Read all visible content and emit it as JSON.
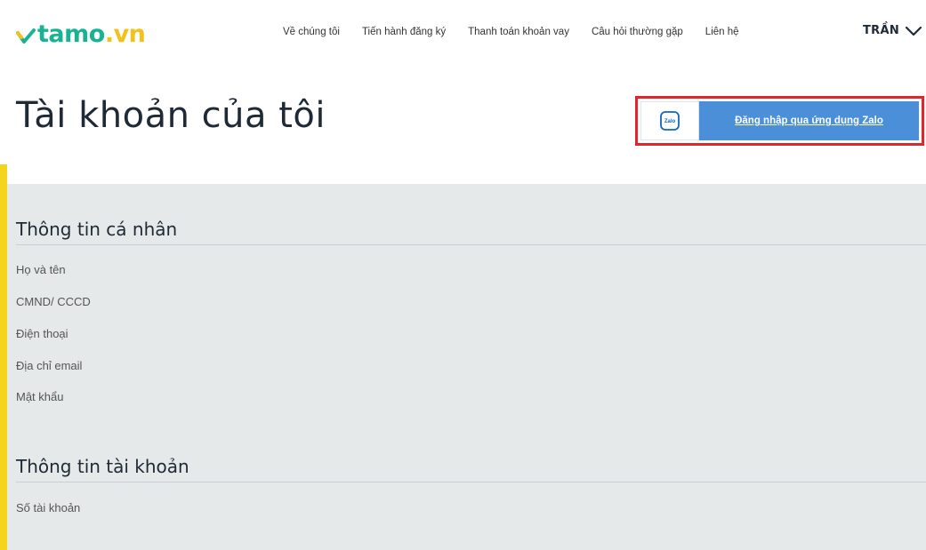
{
  "header": {
    "logo": {
      "brand": "tamo",
      "suffix": ".vn"
    },
    "nav": [
      "Về chúng tôi",
      "Tiến hành đăng ký",
      "Thanh toán khoản vay",
      "Câu hỏi thường gặp",
      "Liên hệ"
    ],
    "user_name": "TRẦN"
  },
  "page": {
    "title": "Tài khoản của tôi"
  },
  "zalo_login": {
    "icon_text": "Zalo",
    "label": "Đăng nhập qua ứng dụng Zalo",
    "brand_color": "#4a8fd8",
    "highlight_color": "#e0252b"
  },
  "sections": {
    "personal": {
      "title": "Thông tin cá nhân",
      "fields": [
        "Họ và tên",
        "CMND/ CCCD",
        "Điện thoại",
        "Địa chỉ email",
        "Mật khẩu"
      ]
    },
    "account": {
      "title": "Thông tin tài khoản",
      "fields": [
        "Số tài khoản"
      ]
    }
  },
  "colors": {
    "brand_green": "#19b394",
    "brand_yellow": "#f2c21b",
    "panel_bg": "#e5e9ea",
    "accent_stripe": "#f4d51d"
  }
}
